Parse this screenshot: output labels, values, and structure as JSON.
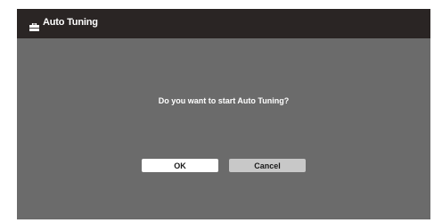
{
  "dialog": {
    "title": "Auto Tuning",
    "title_icon": "toolbox-icon",
    "message": "Do you want to start Auto Tuning?",
    "buttons": {
      "ok_label": "OK",
      "cancel_label": "Cancel"
    }
  },
  "colors": {
    "titlebar": "#2a2524",
    "panel": "#6b6b6b",
    "ok_button": "#ffffff",
    "cancel_button": "#c8c8c8"
  }
}
